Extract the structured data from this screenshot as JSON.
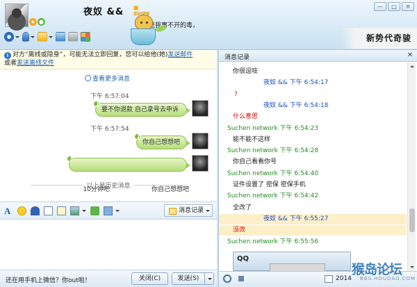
{
  "header": {
    "nickname": "夜奴  &&",
    "vip_label": "SVIP6",
    "signature": "你是我寓不开的毒，",
    "window_controls": [
      "—",
      "□",
      "✕"
    ],
    "ad_text": "新势代奇骏"
  },
  "notice": {
    "prefix": "对方“离线或隐身”，可能无法立即回复，您可以给他(她)",
    "link1": "发送邮件",
    "middle": "或者",
    "link2": "发送离线文件"
  },
  "chat": {
    "more_messages": "查看更多消息",
    "messages": [
      {
        "time": "下午 6:57:04",
        "text": "要不你退款 自己拿号去申诉"
      },
      {
        "time": "下午 6:57:54",
        "text": "你自己想想吧"
      },
      {
        "time": "",
        "text": "10分钟吧                     你自己想想吧"
      }
    ],
    "history_separator": "以上是历史消息"
  },
  "input_toolbar": {
    "icons": [
      "font-icon",
      "emoji-icon",
      "shake-icon",
      "screenshot-icon",
      "note-icon",
      "image-icon",
      "music-icon",
      "screen-share-icon"
    ],
    "message_record_button": "消息记录"
  },
  "bottom": {
    "hint": "还在用手机上微信？你out啦！",
    "close_button": "关闭(C)",
    "send_button": "发送(S)"
  },
  "history_panel": {
    "title": "消息记录",
    "close": "✕",
    "lines": [
      {
        "text": "你很逗吱",
        "color": "#222222",
        "indent": 20,
        "highlight": false
      },
      {
        "text": "夜奴   &&   下午 6:54:17",
        "color": "#1a4fbf",
        "indent": 64,
        "highlight": false
      },
      {
        "text": "?",
        "color": "#e00000",
        "indent": 22,
        "highlight": false
      },
      {
        "text": "夜奴   &&   下午 6:54:18",
        "color": "#1a4fbf",
        "indent": 64,
        "highlight": false
      },
      {
        "text": "什么意思",
        "color": "#e00000",
        "indent": 20,
        "highlight": false
      },
      {
        "text": "Suchen network 下午 6:54:23",
        "color": "#228b22",
        "indent": 12,
        "highlight": false
      },
      {
        "text": "能不能不这样",
        "color": "#222222",
        "indent": 20,
        "highlight": false
      },
      {
        "text": "Suchen network 下午 6:54:28",
        "color": "#228b22",
        "indent": 12,
        "highlight": false
      },
      {
        "text": "你自己看看你号",
        "color": "#222222",
        "indent": 20,
        "highlight": false
      },
      {
        "text": "Suchen network 下午 6:54:40",
        "color": "#228b22",
        "indent": 12,
        "highlight": false
      },
      {
        "text": "证件设置了  密保  密保手机",
        "color": "#222222",
        "indent": 20,
        "highlight": false
      },
      {
        "text": "Suchen network 下午 6:54:42",
        "color": "#228b22",
        "indent": 12,
        "highlight": false
      },
      {
        "text": "全改了",
        "color": "#222222",
        "indent": 20,
        "highlight": false
      },
      {
        "text": "夜奴   &&   下午 6:55:27",
        "color": "#1a4fbf",
        "indent": 64,
        "highlight": true
      },
      {
        "text": "没改",
        "color": "#e00000",
        "indent": 20,
        "highlight": true
      },
      {
        "text": "Suchen network 下午 6:55:56",
        "color": "#228b22",
        "indent": 12,
        "highlight": false
      }
    ],
    "embedded_image_title": "QQ",
    "year": "2014"
  },
  "watermark": {
    "big": "猴岛论坛",
    "small": "BBS.HOUDAO.COM"
  }
}
